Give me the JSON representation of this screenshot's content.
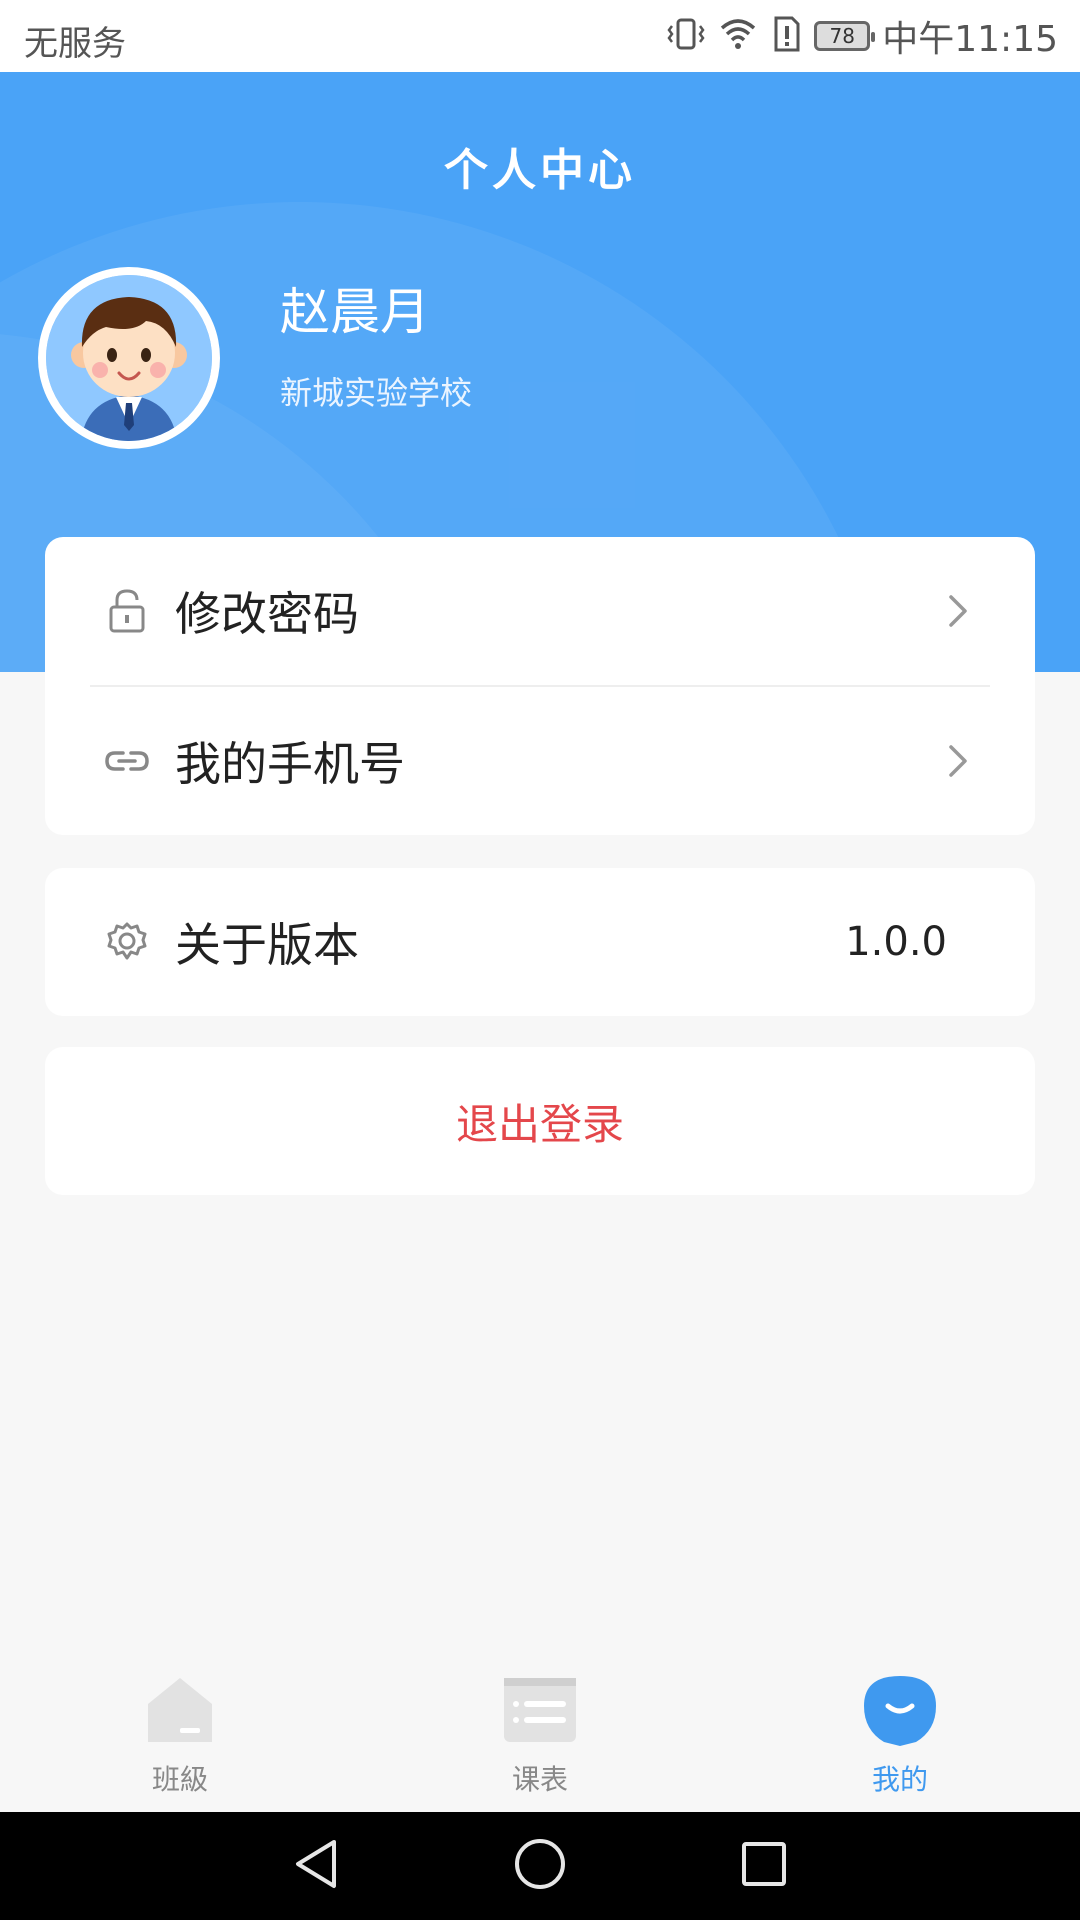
{
  "status_bar": {
    "carrier": "无服务",
    "battery": "78",
    "time": "中午11:15"
  },
  "header": {
    "title": "个人中心",
    "user_name": "赵晨月",
    "school": "新城实验学校"
  },
  "menu": {
    "change_password": "修改密码",
    "my_phone": "我的手机号",
    "about_version": "关于版本",
    "version_value": "1.0.0",
    "logout": "退出登录"
  },
  "bottom_nav": {
    "tabs": [
      {
        "label": "班級",
        "icon": "home-icon",
        "active": false
      },
      {
        "label": "课表",
        "icon": "schedule-icon",
        "active": false
      },
      {
        "label": "我的",
        "icon": "profile-icon",
        "active": true
      }
    ]
  },
  "colors": {
    "header_blue": "#4aa3f7",
    "logout_red": "#e4474b",
    "active_tab": "#3f99ef"
  }
}
